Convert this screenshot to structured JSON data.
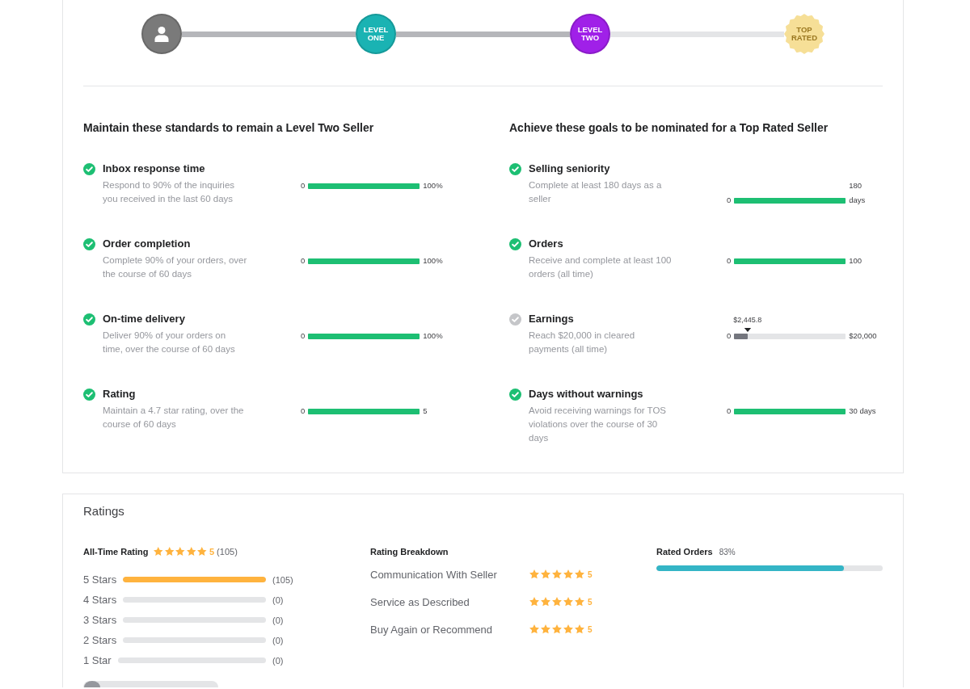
{
  "progress": {
    "steps": [
      {
        "kind": "avatar",
        "color": "#7a7a7a",
        "reached": true
      },
      {
        "kind": "circle",
        "label": "LEVEL ONE",
        "color": "#1ab3b3",
        "reached": true
      },
      {
        "kind": "circle",
        "label": "LEVEL TWO",
        "color": "#a020e8",
        "reached": true
      },
      {
        "kind": "seal",
        "label": "TOP RATED",
        "color": "#f6df97",
        "reached": false
      }
    ]
  },
  "standards": {
    "title": "Maintain these standards to remain a Level Two Seller",
    "items": [
      {
        "title": "Inbox response time",
        "description": "Respond to 90% of the inquiries\nyou received in the last 60 days",
        "met": true,
        "start_label": "0",
        "level": 1,
        "end_label": "100%"
      },
      {
        "title": "Order completion",
        "description": "Complete 90% of your orders, over\nthe course of 60 days",
        "met": true,
        "start_label": "0",
        "level": 1,
        "end_label": "100%"
      },
      {
        "title": "On-time delivery",
        "description": "Deliver 90% of your orders on\ntime, over the course of 60 days",
        "met": true,
        "start_label": "0",
        "level": 1,
        "end_label": "100%"
      },
      {
        "title": "Rating",
        "description": "Maintain a 4.7 star rating, over the\ncourse of 60 days",
        "met": true,
        "start_label": "0",
        "level": 1,
        "end_label": "5"
      }
    ]
  },
  "goals": {
    "title": "Achieve these goals to be nominated for a Top Rated Seller",
    "items": [
      {
        "title": "Selling seniority",
        "description": "Complete at least 180 days as a\nseller",
        "met": true,
        "start_label": "0",
        "level": 1,
        "end_label": "180\ndays"
      },
      {
        "title": "Orders",
        "description": "Receive and complete at least 100\norders (all time)",
        "met": true,
        "start_label": "0",
        "level": 1,
        "end_label": "100"
      },
      {
        "title": "Earnings",
        "description": "Reach $20,000 in cleared\npayments (all time)",
        "met": false,
        "start_label": "0",
        "level": 0.12,
        "marker_label": "$2,445.8",
        "end_label": "$20,000"
      },
      {
        "title": "Days without warnings",
        "description": "Avoid receiving warnings for TOS\nviolations over the course of 30\ndays",
        "met": true,
        "start_label": "0",
        "level": 1,
        "end_label": "30 days"
      }
    ]
  },
  "ratings": {
    "title": "Ratings",
    "all_time": {
      "label": "All-Time Rating",
      "stars": 5,
      "score": "5",
      "count": "(105)"
    },
    "distribution": [
      {
        "label": "5 Stars",
        "level": 1,
        "count": "(105)"
      },
      {
        "label": "4 Stars",
        "level": 0,
        "count": "(0)"
      },
      {
        "label": "3 Stars",
        "level": 0,
        "count": "(0)"
      },
      {
        "label": "2 Stars",
        "level": 0,
        "count": "(0)"
      },
      {
        "label": "1 Star",
        "level": 0,
        "count": "(0)"
      }
    ],
    "breakdown": {
      "title": "Rating Breakdown",
      "rows": [
        {
          "label": "Communication With Seller",
          "stars": 5,
          "score": "5"
        },
        {
          "label": "Service as Described",
          "stars": 5,
          "score": "5"
        },
        {
          "label": "Buy Again or Recommend",
          "stars": 5,
          "score": "5"
        }
      ]
    },
    "rated_orders": {
      "label": "Rated Orders",
      "percent": "83%",
      "level": 0.83
    }
  }
}
